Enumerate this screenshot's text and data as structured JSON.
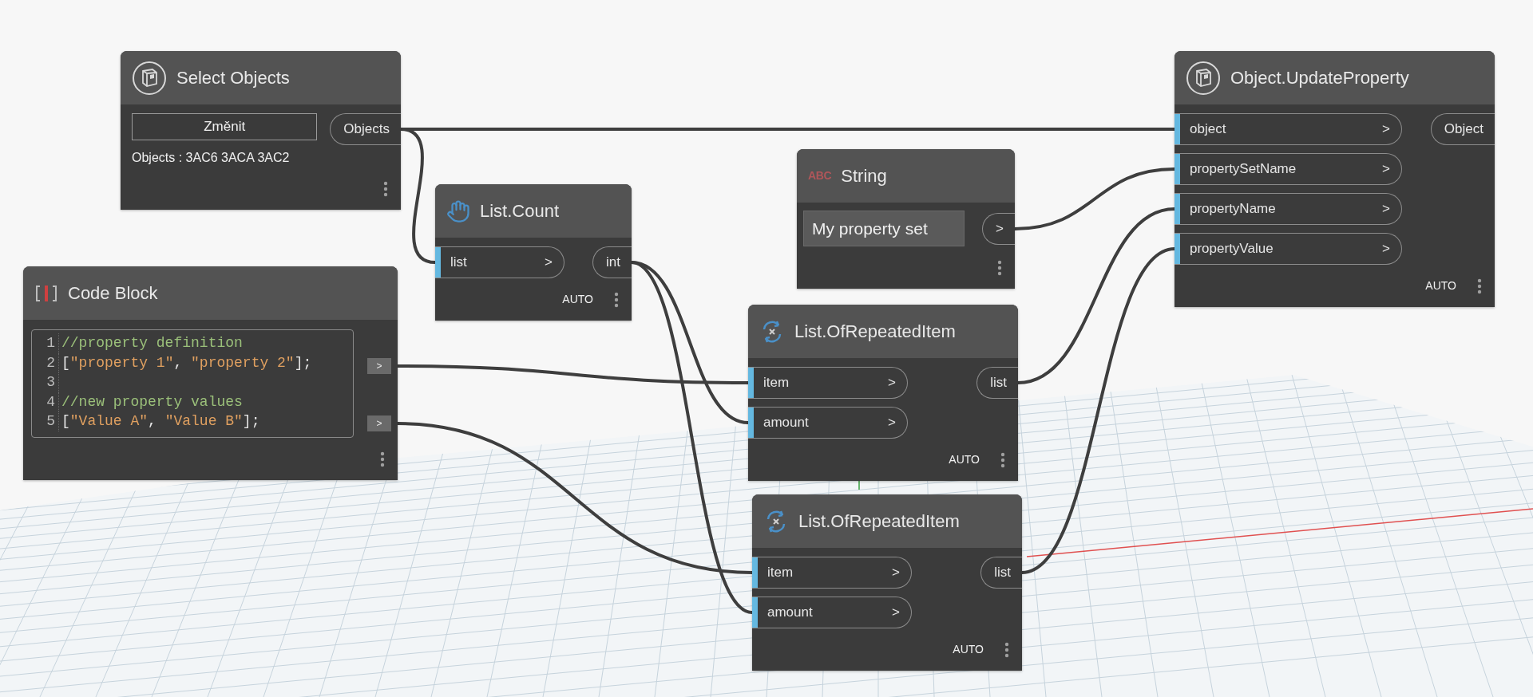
{
  "nodes": [
    {
      "kind": "select",
      "title": "Select Objects",
      "button": "Změnit",
      "info": "Objects : 3AC6 3ACA 3AC2",
      "outputs": [
        "Objects"
      ]
    },
    {
      "kind": "update",
      "title": "Object.UpdateProperty",
      "inputs": [
        {
          "label": "object",
          "arrow": ">"
        },
        {
          "label": "propertySetName",
          "arrow": ">"
        },
        {
          "label": "propertyName",
          "arrow": ">"
        },
        {
          "label": "propertyValue",
          "arrow": ">"
        }
      ],
      "outputs": [
        "Object"
      ],
      "lacing": "AUTO"
    },
    {
      "kind": "string",
      "title": "String",
      "icon_text": "ABC",
      "value": "My property set",
      "outputs": [
        ">"
      ]
    },
    {
      "kind": "count",
      "title": "List.Count",
      "inputs": [
        {
          "label": "list",
          "arrow": ">"
        }
      ],
      "outputs": [
        "int"
      ],
      "lacing": "AUTO"
    },
    {
      "kind": "code",
      "title": "Code Block",
      "lines": [
        {
          "number": "1",
          "tokens": [
            {
              "text": "//property definition",
              "kind": "comment"
            }
          ]
        },
        {
          "number": "2",
          "tokens": [
            {
              "text": "[",
              "kind": "punct"
            },
            {
              "text": "\"property 1\"",
              "kind": "string"
            },
            {
              "text": ", ",
              "kind": "punct"
            },
            {
              "text": "\"property 2\"",
              "kind": "string"
            },
            {
              "text": "];",
              "kind": "punct"
            }
          ]
        },
        {
          "number": "3"
        },
        {
          "number": "4",
          "tokens": [
            {
              "text": "//new property values",
              "kind": "comment"
            }
          ]
        },
        {
          "number": "5",
          "tokens": [
            {
              "text": "[",
              "kind": "punct"
            },
            {
              "text": "\"Value A\"",
              "kind": "string"
            },
            {
              "text": ", ",
              "kind": "punct"
            },
            {
              "text": "\"Value B\"",
              "kind": "string"
            },
            {
              "text": "];",
              "kind": "punct"
            }
          ]
        }
      ],
      "outputs": [
        ">",
        ">"
      ]
    },
    {
      "kind": "function",
      "title": "List.OfRepeatedItem",
      "inputs": [
        {
          "label": "item",
          "arrow": ">"
        },
        {
          "label": "amount",
          "arrow": ">"
        }
      ],
      "outputs": [
        "list"
      ],
      "lacing": "AUTO"
    },
    {
      "kind": "function",
      "title": "List.OfRepeatedItem",
      "inputs": [
        {
          "label": "item",
          "arrow": ">"
        },
        {
          "label": "amount",
          "arrow": ">"
        }
      ],
      "outputs": [
        "list"
      ],
      "lacing": "AUTO"
    }
  ]
}
